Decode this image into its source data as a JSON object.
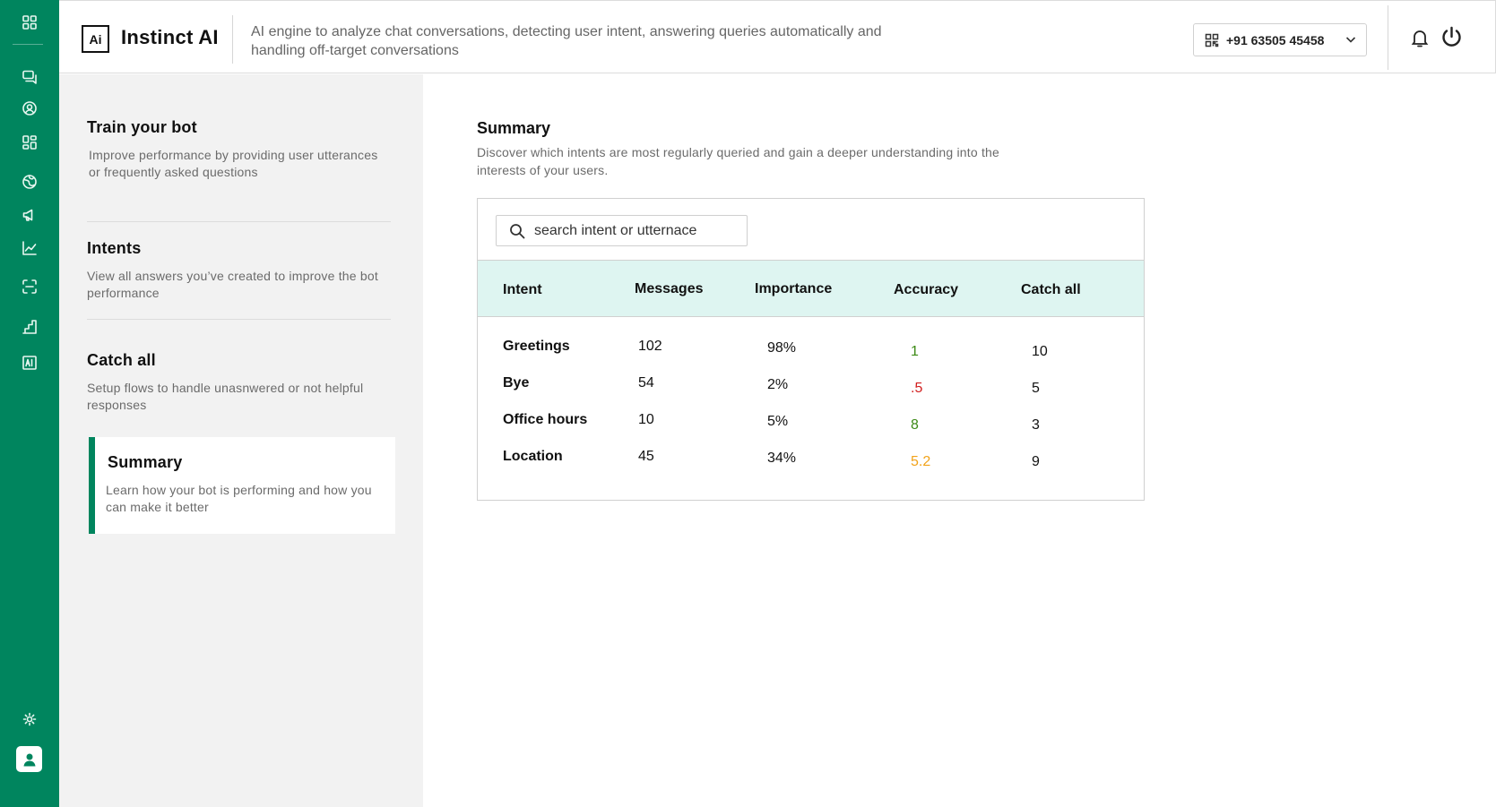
{
  "app": {
    "title": "Instinct AI",
    "logo_text": "Ai",
    "tagline": "AI engine to analyze chat conversations, detecting user intent, answering queries automatically and handling off-target conversations"
  },
  "header": {
    "phone_number": "+91 63505 45458"
  },
  "rail": {
    "icons": [
      "apps-icon",
      "chat-icon",
      "contacts-icon",
      "dashboard-icon",
      "globe-icon",
      "megaphone-icon",
      "analytics-icon",
      "scan-icon",
      "steps-icon",
      "ai-icon",
      "settings-icon",
      "user-icon"
    ]
  },
  "subnav": {
    "items": [
      {
        "title": "Train your bot",
        "desc": "Improve performance by providing user utterances or frequently asked questions"
      },
      {
        "title": "Intents",
        "desc": "View all answers you’ve created to improve the bot performance"
      },
      {
        "title": "Catch all",
        "desc": "Setup flows to handle unasnwered or not helpful responses"
      },
      {
        "title": "Summary",
        "desc": "Learn how your bot is performing and how you can make it better",
        "active": true
      }
    ]
  },
  "summary": {
    "title": "Summary",
    "desc": "Discover which intents are most regularly queried and gain a deeper understanding into the interests of your users.",
    "search_placeholder": "search intent or utternace",
    "columns": [
      "Intent",
      "Messages",
      "Importance",
      "Accuracy",
      "Catch all"
    ],
    "rows": [
      {
        "intent": "Greetings",
        "messages": "102",
        "importance": "98%",
        "accuracy": "1",
        "accuracy_color": "#3c8a16",
        "catch_all": "10"
      },
      {
        "intent": "Bye",
        "messages": "54",
        "importance": "2%",
        "accuracy": ".5",
        "accuracy_color": "#d21f1f",
        "catch_all": "5"
      },
      {
        "intent": "Office hours",
        "messages": "10",
        "importance": "5%",
        "accuracy": "8",
        "accuracy_color": "#3c8a16",
        "catch_all": "3"
      },
      {
        "intent": "Location",
        "messages": "45",
        "importance": "34%",
        "accuracy": "5.2",
        "accuracy_color": "#f2a31a",
        "catch_all": "9"
      }
    ]
  },
  "colors": {
    "brand": "#00855e",
    "table_header_bg": "#def5f1"
  }
}
